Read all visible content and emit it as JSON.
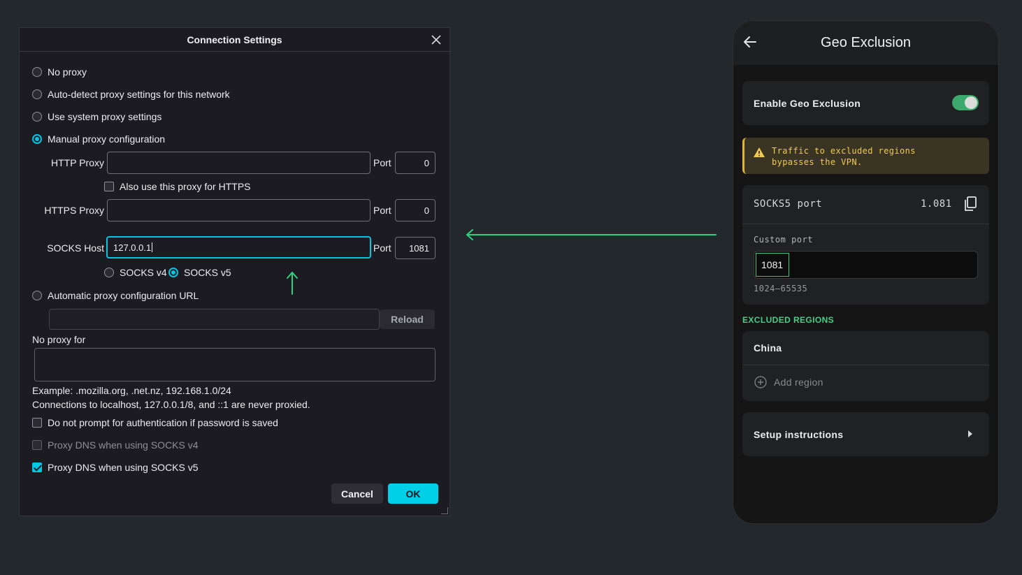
{
  "dialog": {
    "title": "Connection Settings",
    "options": {
      "no_proxy": "No proxy",
      "auto_detect": "Auto-detect proxy settings for this network",
      "system": "Use system proxy settings",
      "manual": "Manual proxy configuration",
      "auto_url": "Automatic proxy configuration URL"
    },
    "selected_option": "manual",
    "http_proxy_label": "HTTP Proxy",
    "http_proxy_value": "",
    "http_port_value": "0",
    "port_label": "Port",
    "also_https_label": "Also use this proxy for HTTPS",
    "also_https_checked": false,
    "https_proxy_label": "HTTPS Proxy",
    "https_proxy_value": "",
    "https_port_value": "0",
    "socks_host_label": "SOCKS Host",
    "socks_host_value": "127.0.0.1",
    "socks_port_value": "1081",
    "socks_v4_label": "SOCKS v4",
    "socks_v5_label": "SOCKS v5",
    "socks_version_selected": "v5",
    "auto_url_value": "",
    "reload_label": "Reload",
    "no_proxy_for_label": "No proxy for",
    "no_proxy_for_value": "",
    "example_text": "Example: .mozilla.org, .net.nz, 192.168.1.0/24",
    "localhost_note": "Connections to localhost, 127.0.0.1/8, and ::1 are never proxied.",
    "no_prompt_auth_label": "Do not prompt for authentication if password is saved",
    "no_prompt_auth_checked": false,
    "proxy_dns_v4_label": "Proxy DNS when using SOCKS v4",
    "proxy_dns_v4_checked": false,
    "proxy_dns_v5_label": "Proxy DNS when using SOCKS v5",
    "proxy_dns_v5_checked": true,
    "cancel_label": "Cancel",
    "ok_label": "OK",
    "close_icon": "close-icon"
  },
  "phone": {
    "title": "Geo Exclusion",
    "back_icon": "back-arrow-icon",
    "enable_label": "Enable Geo Exclusion",
    "enable_on": true,
    "warning_text": "Traffic to excluded regions bypasses the VPN.",
    "socks5_port_label": "SOCKS5 port",
    "socks5_port_value": "1.081",
    "copy_icon": "copy-icon",
    "custom_port_label": "Custom port",
    "custom_port_value": "1081",
    "port_range": "1024–65535",
    "excluded_regions_heading": "EXCLUDED REGIONS",
    "regions": [
      "China"
    ],
    "add_region_label": "Add region",
    "setup_label": "Setup instructions"
  },
  "colors": {
    "accent_cyan": "#00c8e2",
    "accent_green": "#48cf87",
    "warning_yellow": "#f0c94e",
    "background": "#23282d"
  }
}
